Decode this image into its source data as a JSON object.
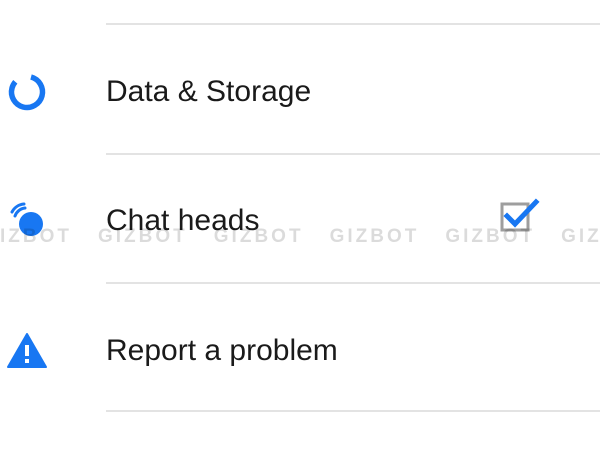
{
  "accent_color": "#1877f2",
  "settings": {
    "items": [
      {
        "label": "Data & Storage",
        "icon": "data-storage-icon"
      },
      {
        "label": "Chat heads",
        "icon": "chat-heads-icon",
        "checked": true
      },
      {
        "label": "Report a problem",
        "icon": "warning-icon"
      }
    ]
  },
  "watermark": {
    "text": [
      "IZBOT",
      "GIZBOT",
      "GIZBOT",
      "GIZBOT",
      "GIZBOT",
      "GIZBOT"
    ]
  }
}
